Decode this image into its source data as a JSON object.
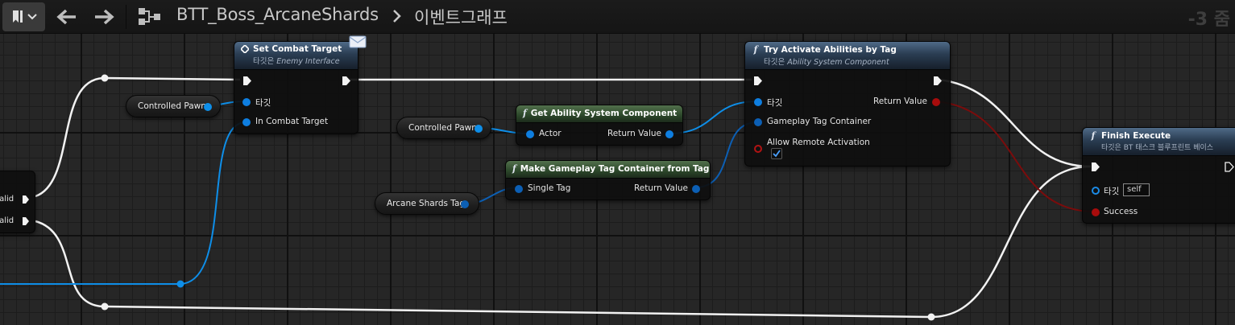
{
  "topbar": {
    "breadcrumb_title": "BTT_Boss_ArcaneShards",
    "breadcrumb_separator": "›",
    "breadcrumb_graph": "이벤트그래프",
    "zoom": "-3 줌",
    "icons": [
      "bookmark-icon",
      "chevron-down-icon",
      "back-arrow-icon",
      "forward-arrow-icon",
      "blueprint-graph-icon"
    ]
  },
  "colors": {
    "exec_wire": "#ffffff",
    "object_wire": "#0e8ee8",
    "struct_wire": "#0c5fb4",
    "bool_wire": "#8a0d0d",
    "function_header": "#2a3d52",
    "pure_header": "#2e4a2c"
  },
  "nodes": {
    "partial_left": {
      "pin1": "Valid",
      "pin2": "Valid"
    },
    "set_combat_target": {
      "title": "Set Combat Target",
      "subtitle_prefix": "타깃은",
      "subtitle_target": "Enemy Interface",
      "pin_target": "타깃",
      "pin_in": "In Combat Target"
    },
    "get_asc": {
      "title": "Get Ability System Component",
      "pin_actor": "Actor",
      "pin_return": "Return Value"
    },
    "make_tag_container": {
      "title": "Make Gameplay Tag Container from Tag",
      "pin_single": "Single Tag",
      "pin_return": "Return Value"
    },
    "try_activate": {
      "title": "Try Activate Abilities by Tag",
      "subtitle_prefix": "타깃은",
      "subtitle_target": "Ability System Component",
      "pin_target": "타깃",
      "pin_container": "Gameplay Tag Container",
      "pin_remote": "Allow Remote Activation",
      "remote_checked": true,
      "pin_return": "Return Value"
    },
    "finish_execute": {
      "title": "Finish Execute",
      "subtitle": "타깃은 BT 태스크 블루프린트 베이스",
      "pin_target": "타깃",
      "self_value": "self",
      "pin_success": "Success"
    }
  },
  "variables": {
    "controlled_pawn_1": "Controlled Pawn",
    "controlled_pawn_2": "Controlled Pawn",
    "arcane_shards_tag": "Arcane Shards Tag"
  }
}
